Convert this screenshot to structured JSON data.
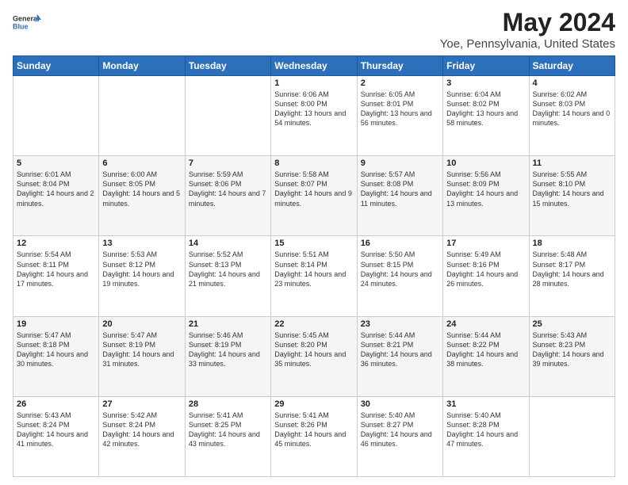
{
  "logo": {
    "general": "General",
    "blue": "Blue"
  },
  "title": "May 2024",
  "subtitle": "Yoe, Pennsylvania, United States",
  "days_of_week": [
    "Sunday",
    "Monday",
    "Tuesday",
    "Wednesday",
    "Thursday",
    "Friday",
    "Saturday"
  ],
  "weeks": [
    [
      {
        "day": "",
        "info": ""
      },
      {
        "day": "",
        "info": ""
      },
      {
        "day": "",
        "info": ""
      },
      {
        "day": "1",
        "info": "Sunrise: 6:06 AM\nSunset: 8:00 PM\nDaylight: 13 hours\nand 54 minutes."
      },
      {
        "day": "2",
        "info": "Sunrise: 6:05 AM\nSunset: 8:01 PM\nDaylight: 13 hours\nand 56 minutes."
      },
      {
        "day": "3",
        "info": "Sunrise: 6:04 AM\nSunset: 8:02 PM\nDaylight: 13 hours\nand 58 minutes."
      },
      {
        "day": "4",
        "info": "Sunrise: 6:02 AM\nSunset: 8:03 PM\nDaylight: 14 hours\nand 0 minutes."
      }
    ],
    [
      {
        "day": "5",
        "info": "Sunrise: 6:01 AM\nSunset: 8:04 PM\nDaylight: 14 hours\nand 2 minutes."
      },
      {
        "day": "6",
        "info": "Sunrise: 6:00 AM\nSunset: 8:05 PM\nDaylight: 14 hours\nand 5 minutes."
      },
      {
        "day": "7",
        "info": "Sunrise: 5:59 AM\nSunset: 8:06 PM\nDaylight: 14 hours\nand 7 minutes."
      },
      {
        "day": "8",
        "info": "Sunrise: 5:58 AM\nSunset: 8:07 PM\nDaylight: 14 hours\nand 9 minutes."
      },
      {
        "day": "9",
        "info": "Sunrise: 5:57 AM\nSunset: 8:08 PM\nDaylight: 14 hours\nand 11 minutes."
      },
      {
        "day": "10",
        "info": "Sunrise: 5:56 AM\nSunset: 8:09 PM\nDaylight: 14 hours\nand 13 minutes."
      },
      {
        "day": "11",
        "info": "Sunrise: 5:55 AM\nSunset: 8:10 PM\nDaylight: 14 hours\nand 15 minutes."
      }
    ],
    [
      {
        "day": "12",
        "info": "Sunrise: 5:54 AM\nSunset: 8:11 PM\nDaylight: 14 hours\nand 17 minutes."
      },
      {
        "day": "13",
        "info": "Sunrise: 5:53 AM\nSunset: 8:12 PM\nDaylight: 14 hours\nand 19 minutes."
      },
      {
        "day": "14",
        "info": "Sunrise: 5:52 AM\nSunset: 8:13 PM\nDaylight: 14 hours\nand 21 minutes."
      },
      {
        "day": "15",
        "info": "Sunrise: 5:51 AM\nSunset: 8:14 PM\nDaylight: 14 hours\nand 23 minutes."
      },
      {
        "day": "16",
        "info": "Sunrise: 5:50 AM\nSunset: 8:15 PM\nDaylight: 14 hours\nand 24 minutes."
      },
      {
        "day": "17",
        "info": "Sunrise: 5:49 AM\nSunset: 8:16 PM\nDaylight: 14 hours\nand 26 minutes."
      },
      {
        "day": "18",
        "info": "Sunrise: 5:48 AM\nSunset: 8:17 PM\nDaylight: 14 hours\nand 28 minutes."
      }
    ],
    [
      {
        "day": "19",
        "info": "Sunrise: 5:47 AM\nSunset: 8:18 PM\nDaylight: 14 hours\nand 30 minutes."
      },
      {
        "day": "20",
        "info": "Sunrise: 5:47 AM\nSunset: 8:19 PM\nDaylight: 14 hours\nand 31 minutes."
      },
      {
        "day": "21",
        "info": "Sunrise: 5:46 AM\nSunset: 8:19 PM\nDaylight: 14 hours\nand 33 minutes."
      },
      {
        "day": "22",
        "info": "Sunrise: 5:45 AM\nSunset: 8:20 PM\nDaylight: 14 hours\nand 35 minutes."
      },
      {
        "day": "23",
        "info": "Sunrise: 5:44 AM\nSunset: 8:21 PM\nDaylight: 14 hours\nand 36 minutes."
      },
      {
        "day": "24",
        "info": "Sunrise: 5:44 AM\nSunset: 8:22 PM\nDaylight: 14 hours\nand 38 minutes."
      },
      {
        "day": "25",
        "info": "Sunrise: 5:43 AM\nSunset: 8:23 PM\nDaylight: 14 hours\nand 39 minutes."
      }
    ],
    [
      {
        "day": "26",
        "info": "Sunrise: 5:43 AM\nSunset: 8:24 PM\nDaylight: 14 hours\nand 41 minutes."
      },
      {
        "day": "27",
        "info": "Sunrise: 5:42 AM\nSunset: 8:24 PM\nDaylight: 14 hours\nand 42 minutes."
      },
      {
        "day": "28",
        "info": "Sunrise: 5:41 AM\nSunset: 8:25 PM\nDaylight: 14 hours\nand 43 minutes."
      },
      {
        "day": "29",
        "info": "Sunrise: 5:41 AM\nSunset: 8:26 PM\nDaylight: 14 hours\nand 45 minutes."
      },
      {
        "day": "30",
        "info": "Sunrise: 5:40 AM\nSunset: 8:27 PM\nDaylight: 14 hours\nand 46 minutes."
      },
      {
        "day": "31",
        "info": "Sunrise: 5:40 AM\nSunset: 8:28 PM\nDaylight: 14 hours\nand 47 minutes."
      },
      {
        "day": "",
        "info": ""
      }
    ]
  ]
}
